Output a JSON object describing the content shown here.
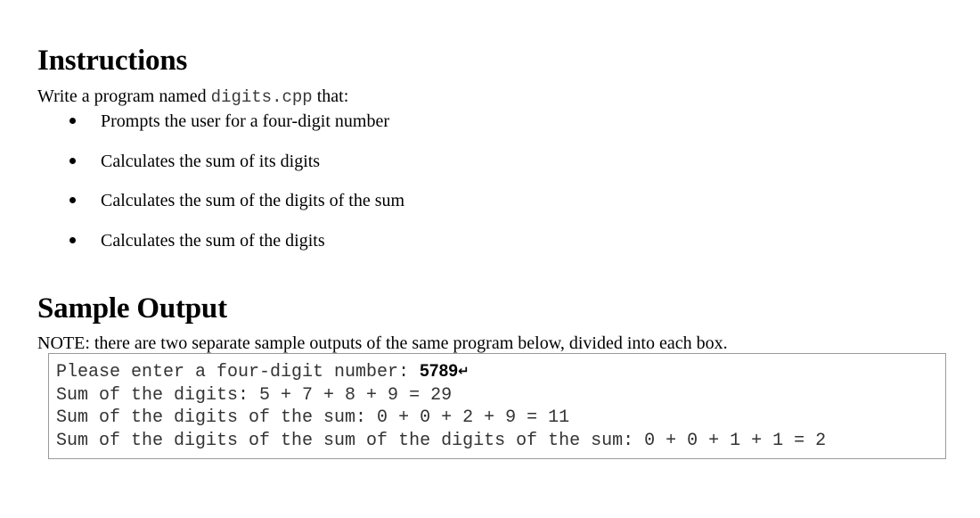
{
  "document": {
    "sections": [
      {
        "heading": "Instructions",
        "intro_before": "Write a program named ",
        "intro_code": "digits.cpp",
        "intro_after": " that:",
        "bullets": [
          "Prompts the user for a four-digit number",
          "Calculates the sum of its digits",
          "Calculates the sum of the digits of the sum",
          "Calculates the sum of the digits"
        ]
      },
      {
        "heading": "Sample Output",
        "note": "NOTE: there are two separate sample outputs of the same program below, divided into each box."
      }
    ],
    "sample_output_box": {
      "prompt_label": "Please enter a four-digit number: ",
      "typed_value": "5789",
      "return_symbol": "↵",
      "lines": [
        "Sum of the digits: 5 + 7 + 8 + 9 = 29",
        "Sum of the digits of the sum: 0 + 0 + 2 + 9 = 11",
        "Sum of the digits of the sum of the digits of the sum: 0 + 0 + 1 + 1 = 2"
      ]
    },
    "colors": {
      "page_background": "#ffffff",
      "body_text": "#000000",
      "code_text": "#333333",
      "box_border": "#9a9a9a",
      "inline_code_text": "#3a3a3a"
    }
  }
}
